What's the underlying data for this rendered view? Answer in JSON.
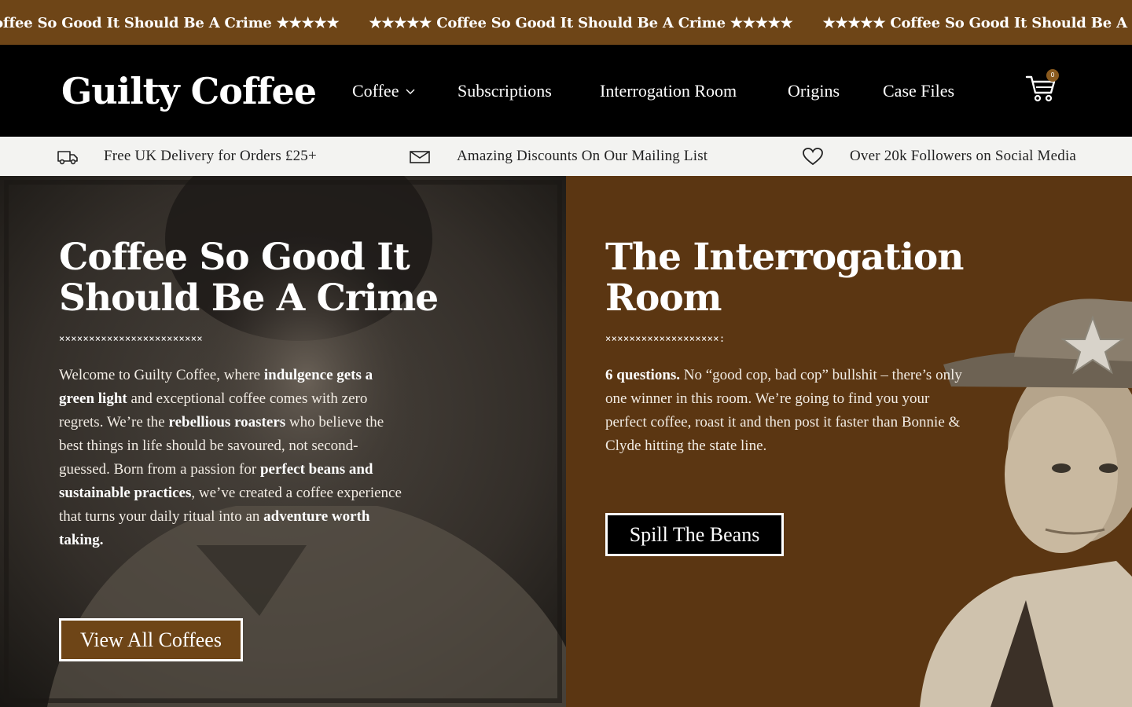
{
  "marquee": {
    "items": [
      "Coffee So Good It Should Be A Crime ★★★★★",
      "★★★★★ Coffee So Good It Should Be A Crime ★★★★★",
      "★★★★★ Coffee So Good It Should Be A Crime ★★★★★"
    ]
  },
  "header": {
    "logo": "Guilty Coffee",
    "nav": [
      {
        "label": "Coffee"
      },
      {
        "label": "Subscriptions"
      },
      {
        "label": "Interrogation Room"
      },
      {
        "label": "Origins"
      },
      {
        "label": "Case Files"
      }
    ],
    "cart_count": "0",
    "icons": {
      "cart": "cart-icon",
      "dropdown": "chevron-down-icon"
    }
  },
  "infobar": {
    "items": [
      {
        "icon": "delivery-van-icon",
        "text": "Free UK Delivery for Orders £25+"
      },
      {
        "icon": "envelope-icon",
        "text": "Amazing Discounts On Our Mailing List"
      },
      {
        "icon": "heart-icon",
        "text": "Over 20k Followers on Social Media"
      }
    ]
  },
  "hero_left": {
    "title_line1": "Coffee So Good It",
    "title_line2": "Should Be A Crime",
    "divider": "××××××××××××××××××××××××",
    "body": {
      "p1": "Welcome to Guilty Coffee, where ",
      "b1": "indulgence gets a green light",
      "p2": " and exceptional coffee comes with zero regrets. We’re the ",
      "b2": "rebellious roasters",
      "p3": " who believe the best things in life should be savoured, not second-guessed. Born from a passion for ",
      "b3": "perfect beans and sustainable practices",
      "p4": ", we’ve created a coffee experience that turns your daily ritual into an ",
      "b4": "adventure worth taking."
    },
    "button": "View All Coffees"
  },
  "hero_right": {
    "title_line1": "The Interrogation",
    "title_line2": "Room",
    "divider": "×××××××××××××××××××:",
    "body": {
      "b1": "6 questions.",
      "p1": " No “good cop, bad cop” bullshit – there’s only one winner in this room. We’re going to find you your perfect coffee, roast it and then post it faster than Bonnie & Clyde hitting the state line."
    },
    "button": "Spill The Beans"
  },
  "colors": {
    "brand_brown": "#6e4517",
    "panel_brown": "#5b3612",
    "header_black": "#000000",
    "infobar_bg": "#f3f3f1"
  }
}
